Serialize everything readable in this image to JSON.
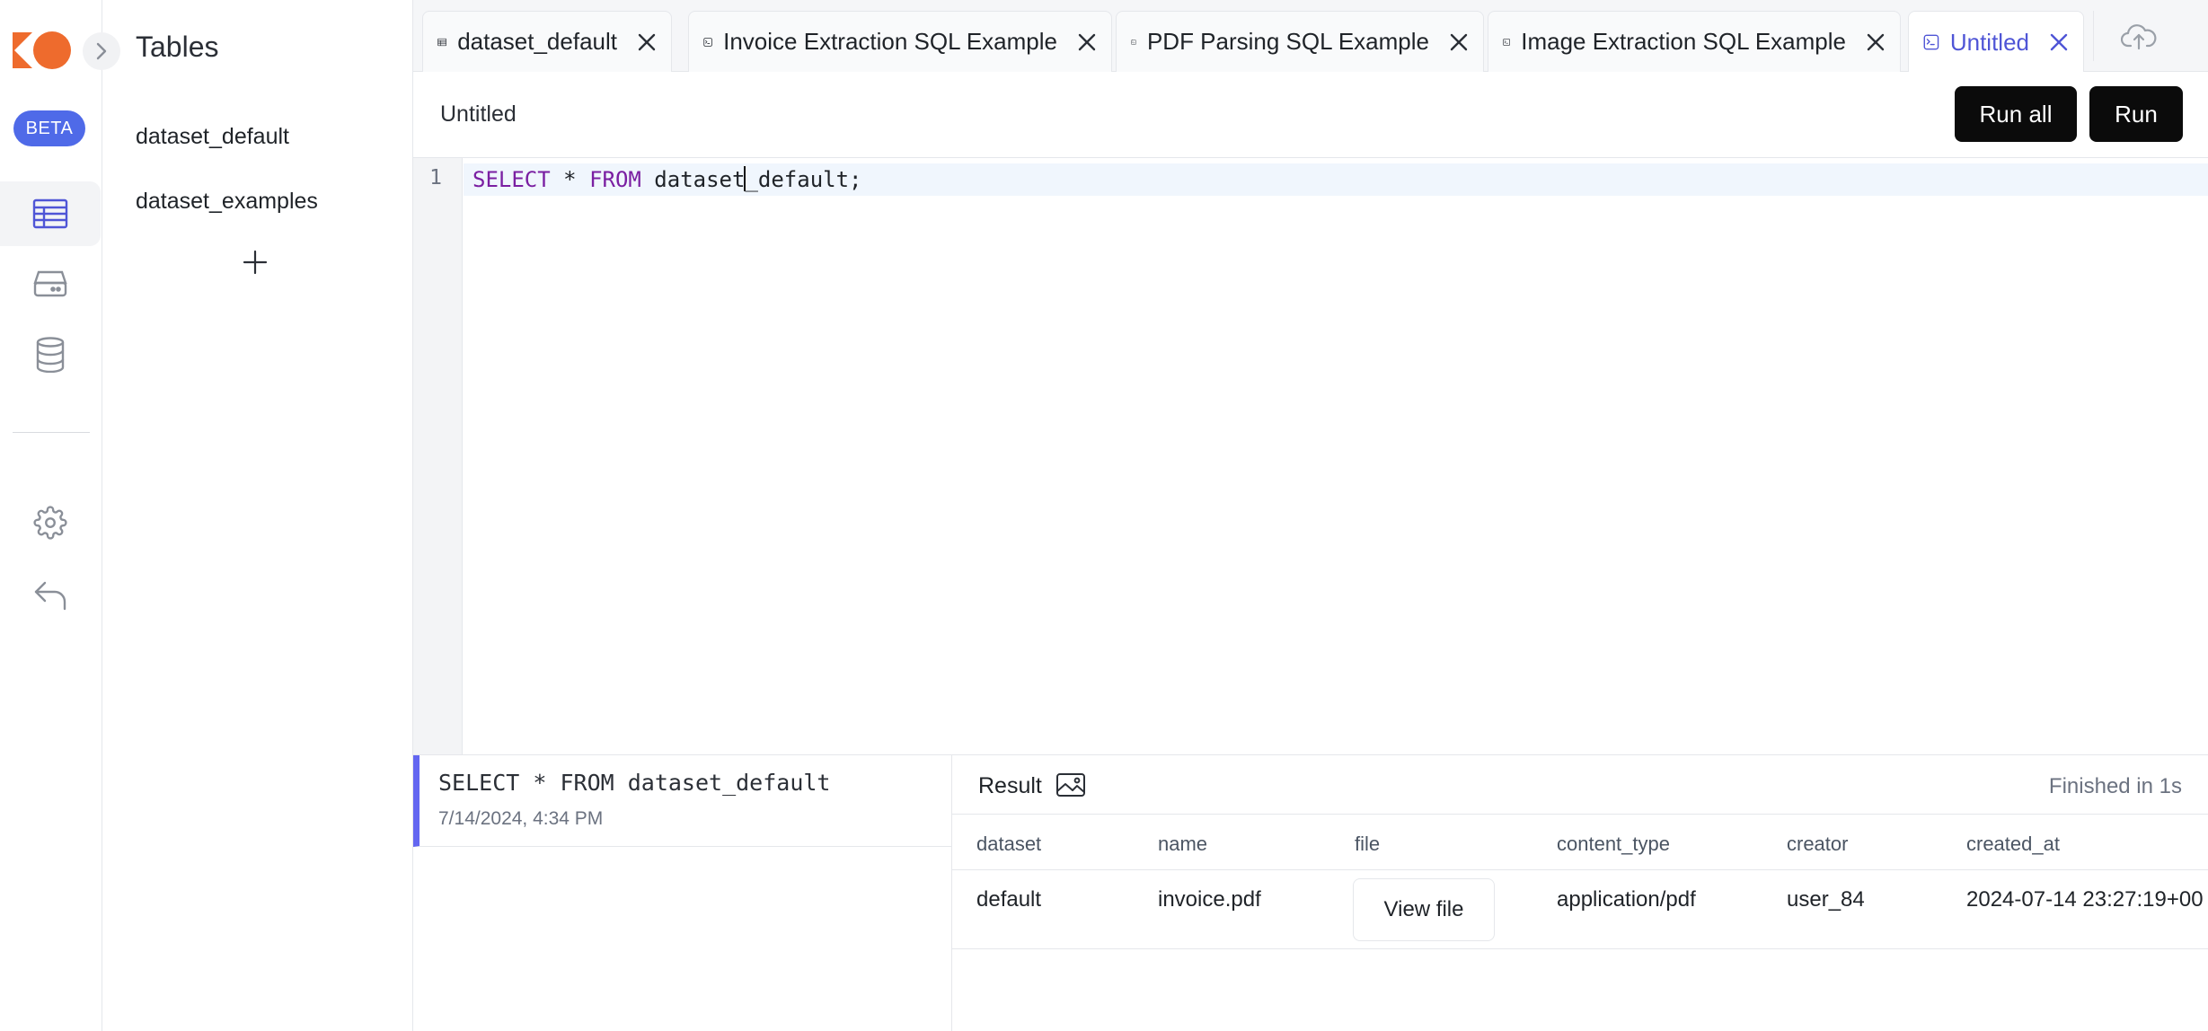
{
  "app": {
    "brand_colors": {
      "logo": "#ee6b2d",
      "accent": "#4f6ae8",
      "active_tab": "#4f55d6",
      "history_marker": "#6366f1"
    },
    "beta_label": "BETA"
  },
  "rail": {
    "items": [
      {
        "name": "tables",
        "icon": "table-icon",
        "active": true
      },
      {
        "name": "storage",
        "icon": "server-icon",
        "active": false
      },
      {
        "name": "database",
        "icon": "database-icon",
        "active": false
      },
      {
        "name": "settings",
        "icon": "gear-icon",
        "active": false
      },
      {
        "name": "back",
        "icon": "undo-arrow-icon",
        "active": false
      }
    ]
  },
  "tables_panel": {
    "title": "Tables",
    "items": [
      "dataset_default",
      "dataset_examples"
    ]
  },
  "tabs": [
    {
      "label": "dataset_default",
      "icon": "table-icon",
      "active": false
    },
    {
      "label": "Invoice Extraction SQL Example",
      "icon": "terminal-icon",
      "active": false
    },
    {
      "label": "PDF Parsing SQL Example",
      "icon": "terminal-icon",
      "active": false
    },
    {
      "label": "Image Extraction SQL Example",
      "icon": "terminal-icon",
      "active": false
    },
    {
      "label": "Untitled",
      "icon": "terminal-icon",
      "active": true
    }
  ],
  "toolbar": {
    "title": "Untitled",
    "run_all_label": "Run all",
    "run_label": "Run"
  },
  "editor": {
    "line_numbers": [
      "1"
    ],
    "code": {
      "kw1": "SELECT",
      "op": " * ",
      "kw2": "FROM",
      "before_caret": " dataset",
      "after_caret": "_default;"
    }
  },
  "history": {
    "items": [
      {
        "query": "SELECT * FROM dataset_default",
        "time": "7/14/2024, 4:34 PM"
      }
    ]
  },
  "results": {
    "label": "Result",
    "status": "Finished in 1s",
    "columns": [
      "dataset",
      "name",
      "file",
      "content_type",
      "creator",
      "created_at"
    ],
    "rows": [
      {
        "dataset": "default",
        "name": "invoice.pdf",
        "file": "View file",
        "content_type": "application/pdf",
        "creator": "user_84",
        "created_at": "2024-07-14 23:27:19+00"
      }
    ]
  }
}
